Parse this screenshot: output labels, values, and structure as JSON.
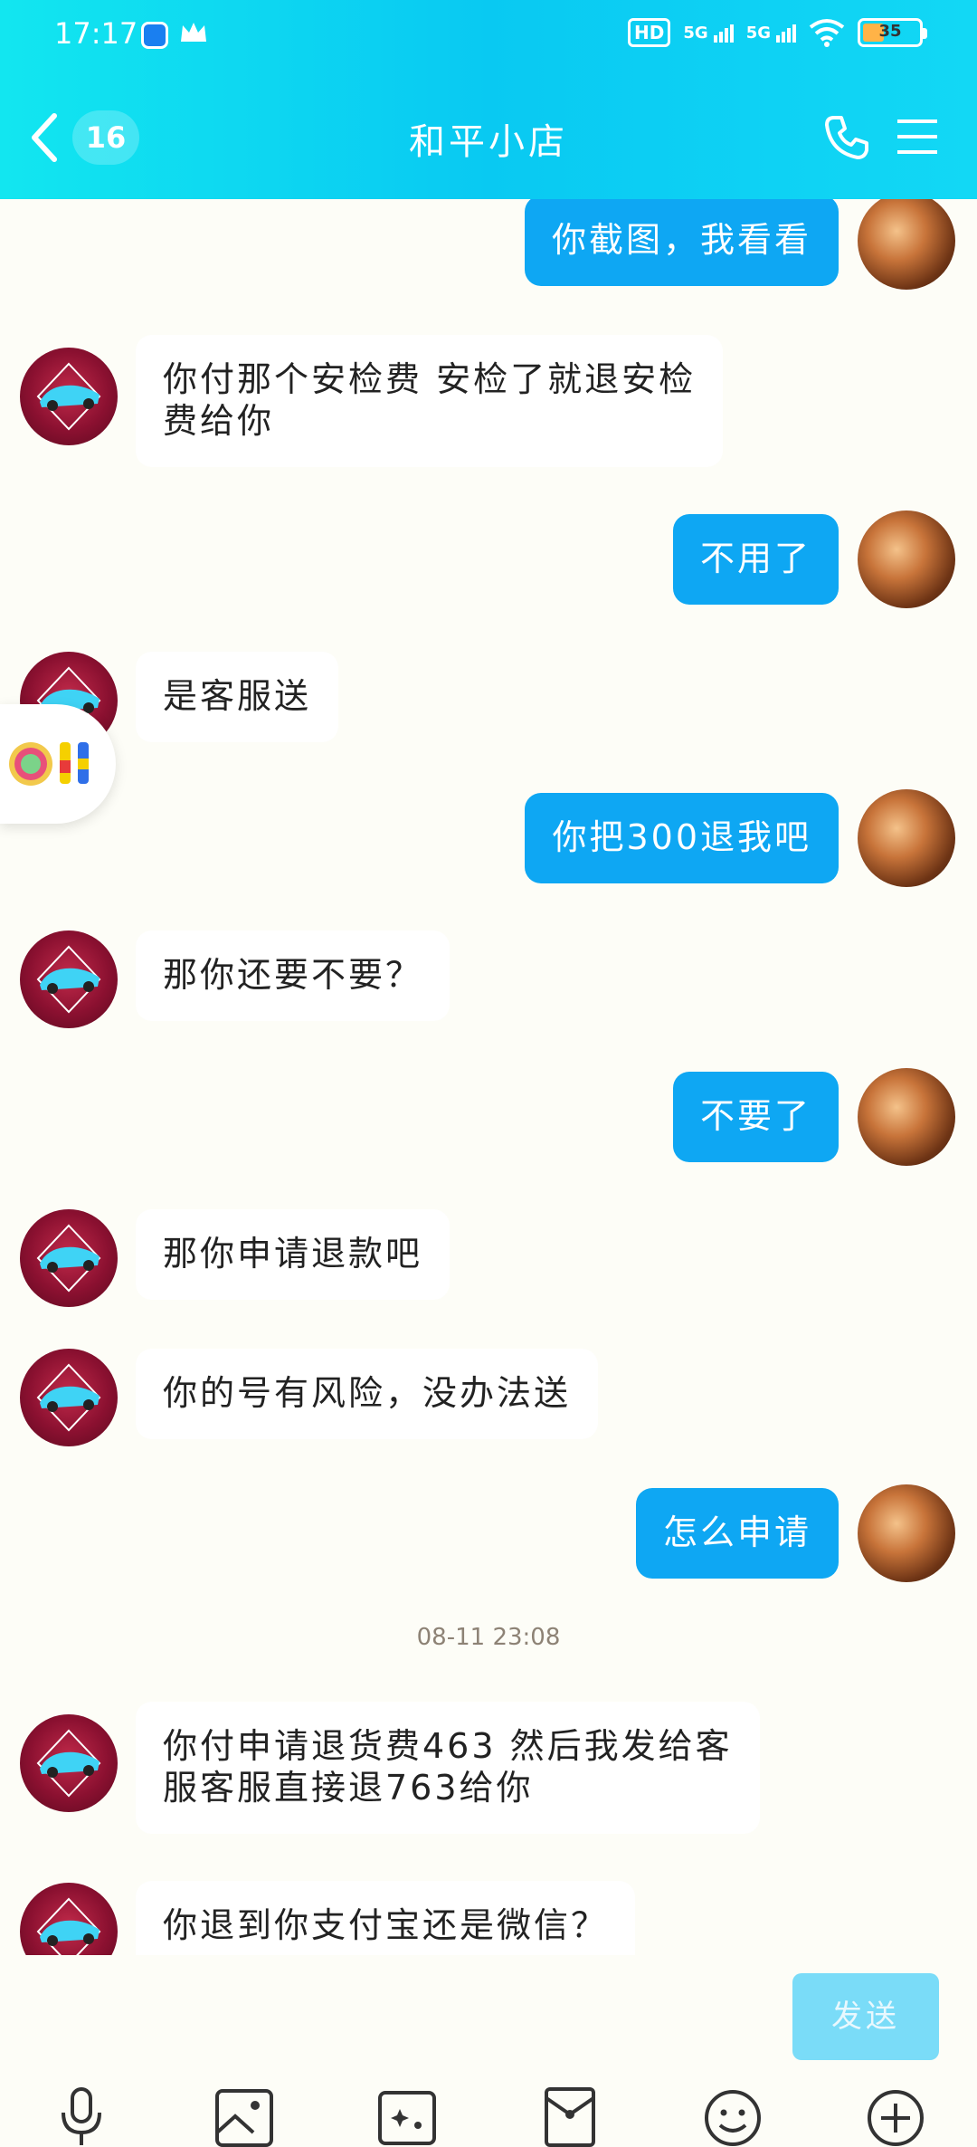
{
  "status_bar": {
    "time": "17:17",
    "network1": "5G",
    "network2": "5G",
    "hd": "HD",
    "battery_level": "35"
  },
  "header": {
    "unread_count": "16",
    "title": "和平小店"
  },
  "messages": [
    {
      "from": "self",
      "text": "你截图，我看看"
    },
    {
      "from": "peer",
      "text": "你付那个安检费 安检了就退安检\n费给你"
    },
    {
      "from": "self",
      "text": "不用了"
    },
    {
      "from": "peer",
      "text": "是客服送"
    },
    {
      "from": "self",
      "text": "你把300退我吧"
    },
    {
      "from": "peer",
      "text": "那你还要不要？"
    },
    {
      "from": "self",
      "text": "不要了"
    },
    {
      "from": "peer",
      "text": "那你申请退款吧"
    },
    {
      "from": "peer",
      "text": "你的号有风险，没办法送"
    },
    {
      "from": "self",
      "text": "怎么申请"
    },
    {
      "from": "peer",
      "text": "你付申请退货费463 然后我发给客\n服客服直接退763给你"
    },
    {
      "from": "peer",
      "text": "你退到你支付宝还是微信？"
    }
  ],
  "timestamp": "08-11 23:08",
  "input": {
    "send_label": "发送"
  },
  "toolbar_icons": [
    "microphone-icon",
    "image-icon",
    "camera-icon",
    "red-packet-icon",
    "emoji-icon",
    "plus-icon"
  ],
  "colors": {
    "header_gradient_start": "#12e6f0",
    "self_bubble": "#0ea7f3",
    "peer_bubble": "#ffffff",
    "send_button": "#7adcf8",
    "background": "#fdfdf7"
  }
}
